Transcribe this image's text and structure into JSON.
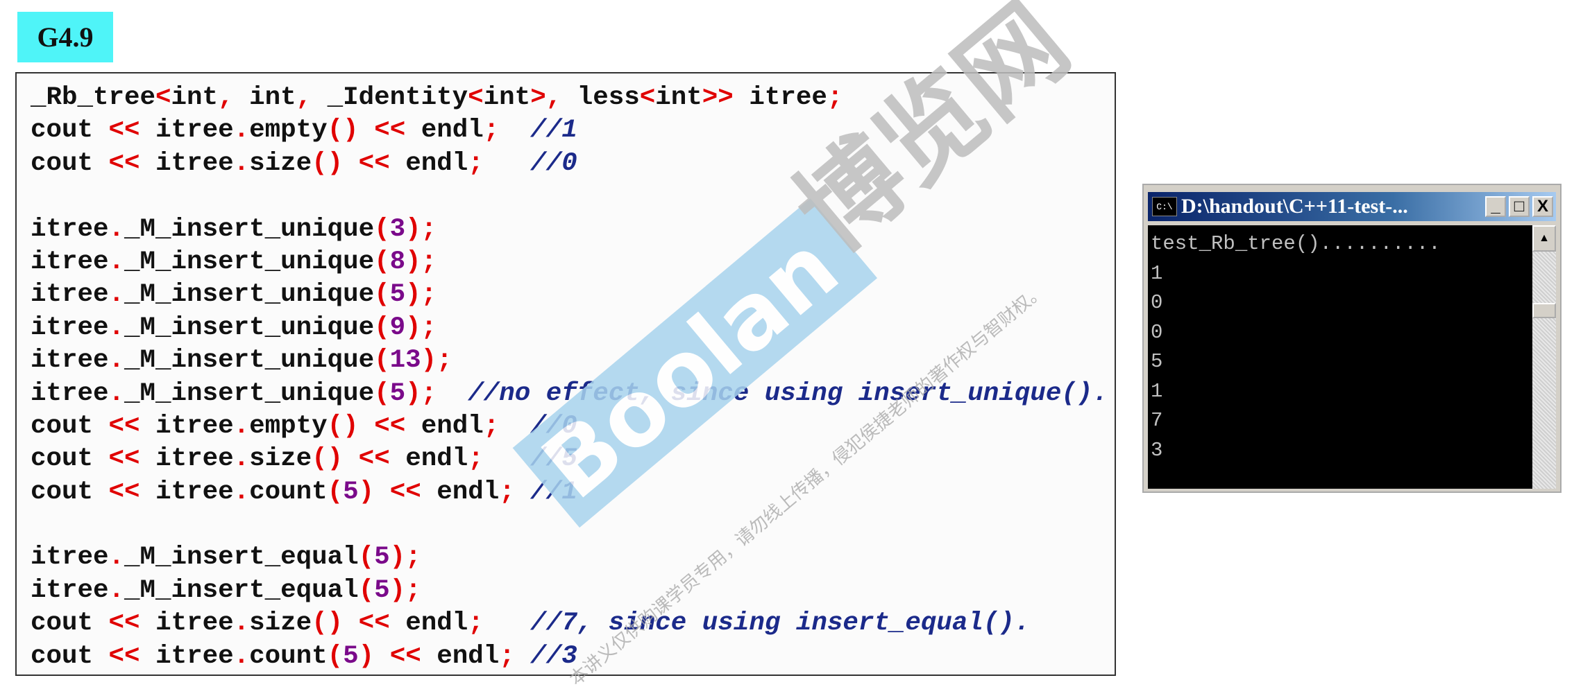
{
  "slide_tag": "G4.9",
  "code_lines": [
    "_Rb_tree<int, int, _Identity<int>, less<int>> itree;",
    "cout << itree.empty() << endl;  //1",
    "cout << itree.size() << endl;   //0",
    "",
    "itree._M_insert_unique(3);",
    "itree._M_insert_unique(8);",
    "itree._M_insert_unique(5);",
    "itree._M_insert_unique(9);",
    "itree._M_insert_unique(13);",
    "itree._M_insert_unique(5);  //no effect, since using insert_unique().",
    "cout << itree.empty() << endl;  //0",
    "cout << itree.size() << endl;   //5",
    "cout << itree.count(5) << endl; //1",
    "",
    "itree._M_insert_equal(5);",
    "itree._M_insert_equal(5);",
    "cout << itree.size() << endl;   //7, since using insert_equal().",
    "cout << itree.count(5) << endl; //3"
  ],
  "console": {
    "icon_label": "C:\\",
    "title": "D:\\handout\\C++11-test-...",
    "minimize": "_",
    "maximize": "□",
    "close": "X",
    "scroll_up": "▲",
    "output": [
      "test_Rb_tree()..........",
      "1",
      "0",
      "0",
      "5",
      "1",
      "7",
      "3"
    ]
  },
  "watermark": {
    "site": "博览网",
    "brand": "Boolan",
    "notice": "本讲义仅供购课学员专用，请勿线上传播，侵犯侯捷老师的著作权与智财权。"
  }
}
